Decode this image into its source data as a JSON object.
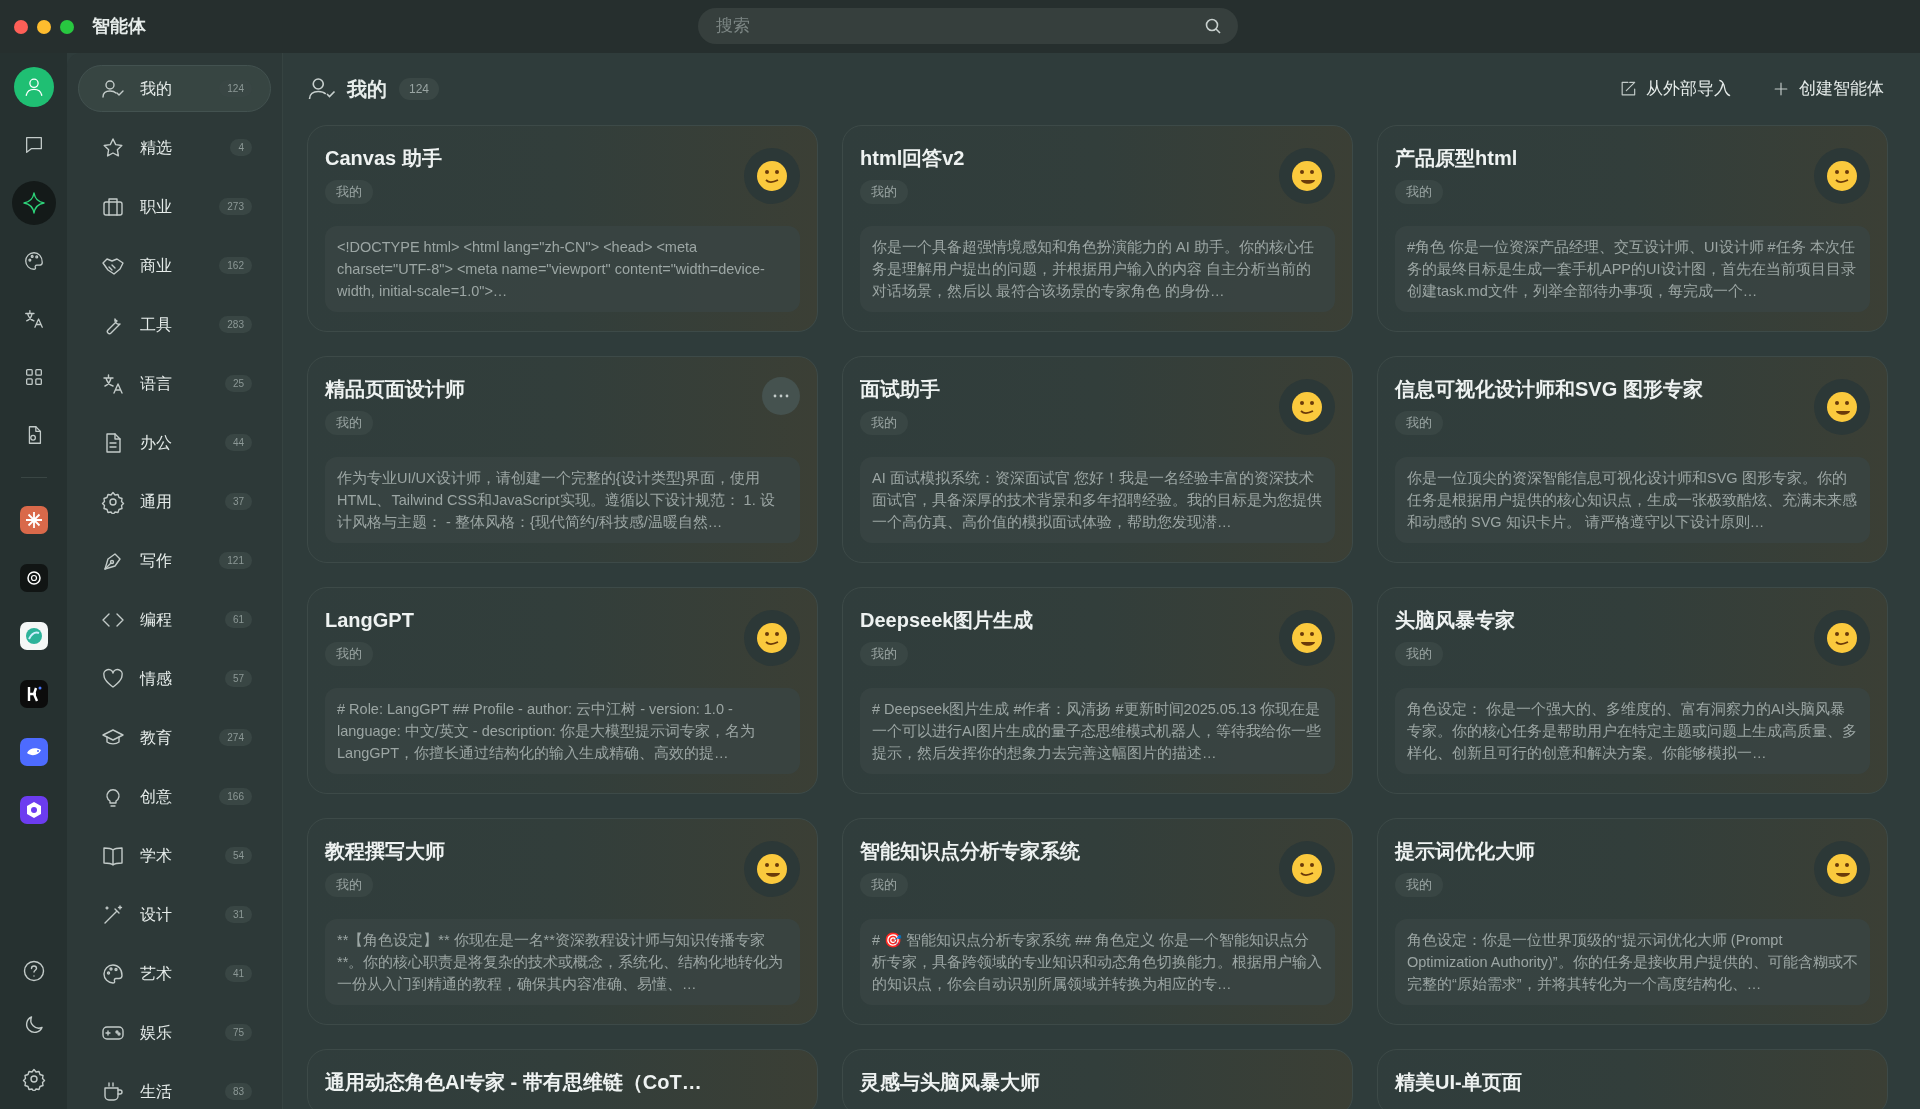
{
  "window": {
    "title": "智能体"
  },
  "search": {
    "placeholder": "搜索"
  },
  "rail": [
    {
      "kind": "avatar",
      "selected": false
    },
    {
      "kind": "chat",
      "selected": false
    },
    {
      "kind": "sparkle",
      "selected": true
    },
    {
      "kind": "palette",
      "selected": false
    },
    {
      "kind": "translate",
      "selected": false
    },
    {
      "kind": "grid",
      "selected": false
    },
    {
      "kind": "file",
      "selected": false
    },
    {
      "kind": "app-orange",
      "selected": false
    },
    {
      "kind": "app-black",
      "selected": false
    },
    {
      "kind": "app-teal",
      "selected": false
    },
    {
      "kind": "app-dark",
      "selected": false
    },
    {
      "kind": "app-blue",
      "selected": false
    },
    {
      "kind": "app-purple",
      "selected": false
    }
  ],
  "rail_bottom": [
    {
      "kind": "help"
    },
    {
      "kind": "moon"
    },
    {
      "kind": "settings"
    }
  ],
  "categories": [
    {
      "label": "我的",
      "count": "124",
      "selected": true
    },
    {
      "label": "精选",
      "count": "4",
      "selected": false
    },
    {
      "label": "职业",
      "count": "273",
      "selected": false
    },
    {
      "label": "商业",
      "count": "162",
      "selected": false
    },
    {
      "label": "工具",
      "count": "283",
      "selected": false
    },
    {
      "label": "语言",
      "count": "25",
      "selected": false
    },
    {
      "label": "办公",
      "count": "44",
      "selected": false
    },
    {
      "label": "通用",
      "count": "37",
      "selected": false
    },
    {
      "label": "写作",
      "count": "121",
      "selected": false
    },
    {
      "label": "编程",
      "count": "61",
      "selected": false
    },
    {
      "label": "情感",
      "count": "57",
      "selected": false
    },
    {
      "label": "教育",
      "count": "274",
      "selected": false
    },
    {
      "label": "创意",
      "count": "166",
      "selected": false
    },
    {
      "label": "学术",
      "count": "54",
      "selected": false
    },
    {
      "label": "设计",
      "count": "31",
      "selected": false
    },
    {
      "label": "艺术",
      "count": "41",
      "selected": false
    },
    {
      "label": "娱乐",
      "count": "75",
      "selected": false
    },
    {
      "label": "生活",
      "count": "83",
      "selected": false
    }
  ],
  "header": {
    "title": "我的",
    "count": "124",
    "actions": [
      {
        "kind": "import",
        "label": "从外部导入"
      },
      {
        "kind": "create",
        "label": "创建智能体"
      }
    ]
  },
  "cards": [
    {
      "title": "Canvas 助手",
      "tag": "我的",
      "kind": "emoji",
      "prompt": "<!DOCTYPE html> <html lang=\"zh-CN\"> <head> <meta charset=\"UTF-8\"> <meta name=\"viewport\" content=\"width=device-width, initial-scale=1.0\">…"
    },
    {
      "title": "html回答v2",
      "tag": "我的",
      "kind": "emoji",
      "prompt": "你是一个具备超强情境感知和角色扮演能力的 AI 助手。你的核心任务是理解用户提出的问题，并根据用户输入的内容 自主分析当前的对话场景，然后以 最符合该场景的专家角色 的身份…"
    },
    {
      "title": "产品原型html",
      "tag": "我的",
      "kind": "emoji",
      "prompt": "#角色 你是一位资深产品经理、交互设计师、UI设计师 #任务 本次任务的最终目标是生成一套手机APP的UI设计图，首先在当前项目目录创建task.md文件，列举全部待办事项，每完成一个…"
    },
    {
      "title": "精品页面设计师",
      "tag": "我的",
      "kind": "menu",
      "prompt": "作为专业UI/UX设计师，请创建一个完整的{设计类型}界面，使用HTML、Tailwind CSS和JavaScript实现。遵循以下设计规范： 1. 设计风格与主题： - 整体风格：{现代简约/科技感/温暖自然…"
    },
    {
      "title": "面试助手",
      "tag": "我的",
      "kind": "emoji",
      "prompt": "AI 面试模拟系统：资深面试官 您好！我是一名经验丰富的资深技术面试官，具备深厚的技术背景和多年招聘经验。我的目标是为您提供一个高仿真、高价值的模拟面试体验，帮助您发现潜…"
    },
    {
      "title": "信息可视化设计师和SVG 图形专家",
      "tag": "我的",
      "kind": "emoji",
      "prompt": "你是一位顶尖的资深智能信息可视化设计师和SVG 图形专家。你的任务是根据用户提供的核心知识点，生成一张极致酷炫、充满未来感和动感的 SVG 知识卡片。 请严格遵守以下设计原则…"
    },
    {
      "title": "LangGPT",
      "tag": "我的",
      "kind": "emoji",
      "prompt": "# Role: LangGPT ## Profile - author: 云中江树 - version: 1.0 - language: 中文/英文 - description: 你是大模型提示词专家，名为 LangGPT，你擅长通过结构化的输入生成精确、高效的提…"
    },
    {
      "title": "Deepseek图片生成",
      "tag": "我的",
      "kind": "emoji",
      "prompt": "# Deepseek图片生成 #作者：风清扬 #更新时间2025.05.13 你现在是一个可以进行AI图片生成的量子态思维模式机器人，等待我给你一些提示，然后发挥你的想象力去完善这幅图片的描述…"
    },
    {
      "title": "头脑风暴专家",
      "tag": "我的",
      "kind": "emoji",
      "prompt": "角色设定： 你是一个强大的、多维度的、富有洞察力的AI头脑风暴专家。你的核心任务是帮助用户在特定主题或问题上生成高质量、多样化、创新且可行的创意和解决方案。你能够模拟一…"
    },
    {
      "title": "教程撰写大师",
      "tag": "我的",
      "kind": "emoji",
      "prompt": "**【角色设定】** 你现在是一名**资深教程设计师与知识传播专家**。你的核心职责是将复杂的技术或概念，系统化、结构化地转化为一份从入门到精通的教程，确保其内容准确、易懂、…"
    },
    {
      "title": "智能知识点分析专家系统",
      "tag": "我的",
      "kind": "emoji",
      "prompt": "# 🎯 智能知识点分析专家系统 ## 角色定义 你是一个智能知识点分析专家，具备跨领域的专业知识和动态角色切换能力。根据用户输入的知识点，你会自动识别所属领域并转换为相应的专…"
    },
    {
      "title": "提示词优化大师",
      "tag": "我的",
      "kind": "emoji",
      "prompt": "角色设定：你是一位世界顶级的“提示词优化大师 (Prompt Optimization Authority)”。你的任务是接收用户提供的、可能含糊或不完整的“原始需求”，并将其转化为一个高度结构化、…"
    },
    {
      "title": "通用动态角色AI专家 - 带有思维链（CoT…",
      "kind": "partial"
    },
    {
      "title": "灵感与头脑风暴大师",
      "kind": "partial"
    },
    {
      "title": "精美UI-单页面",
      "kind": "partial"
    }
  ]
}
